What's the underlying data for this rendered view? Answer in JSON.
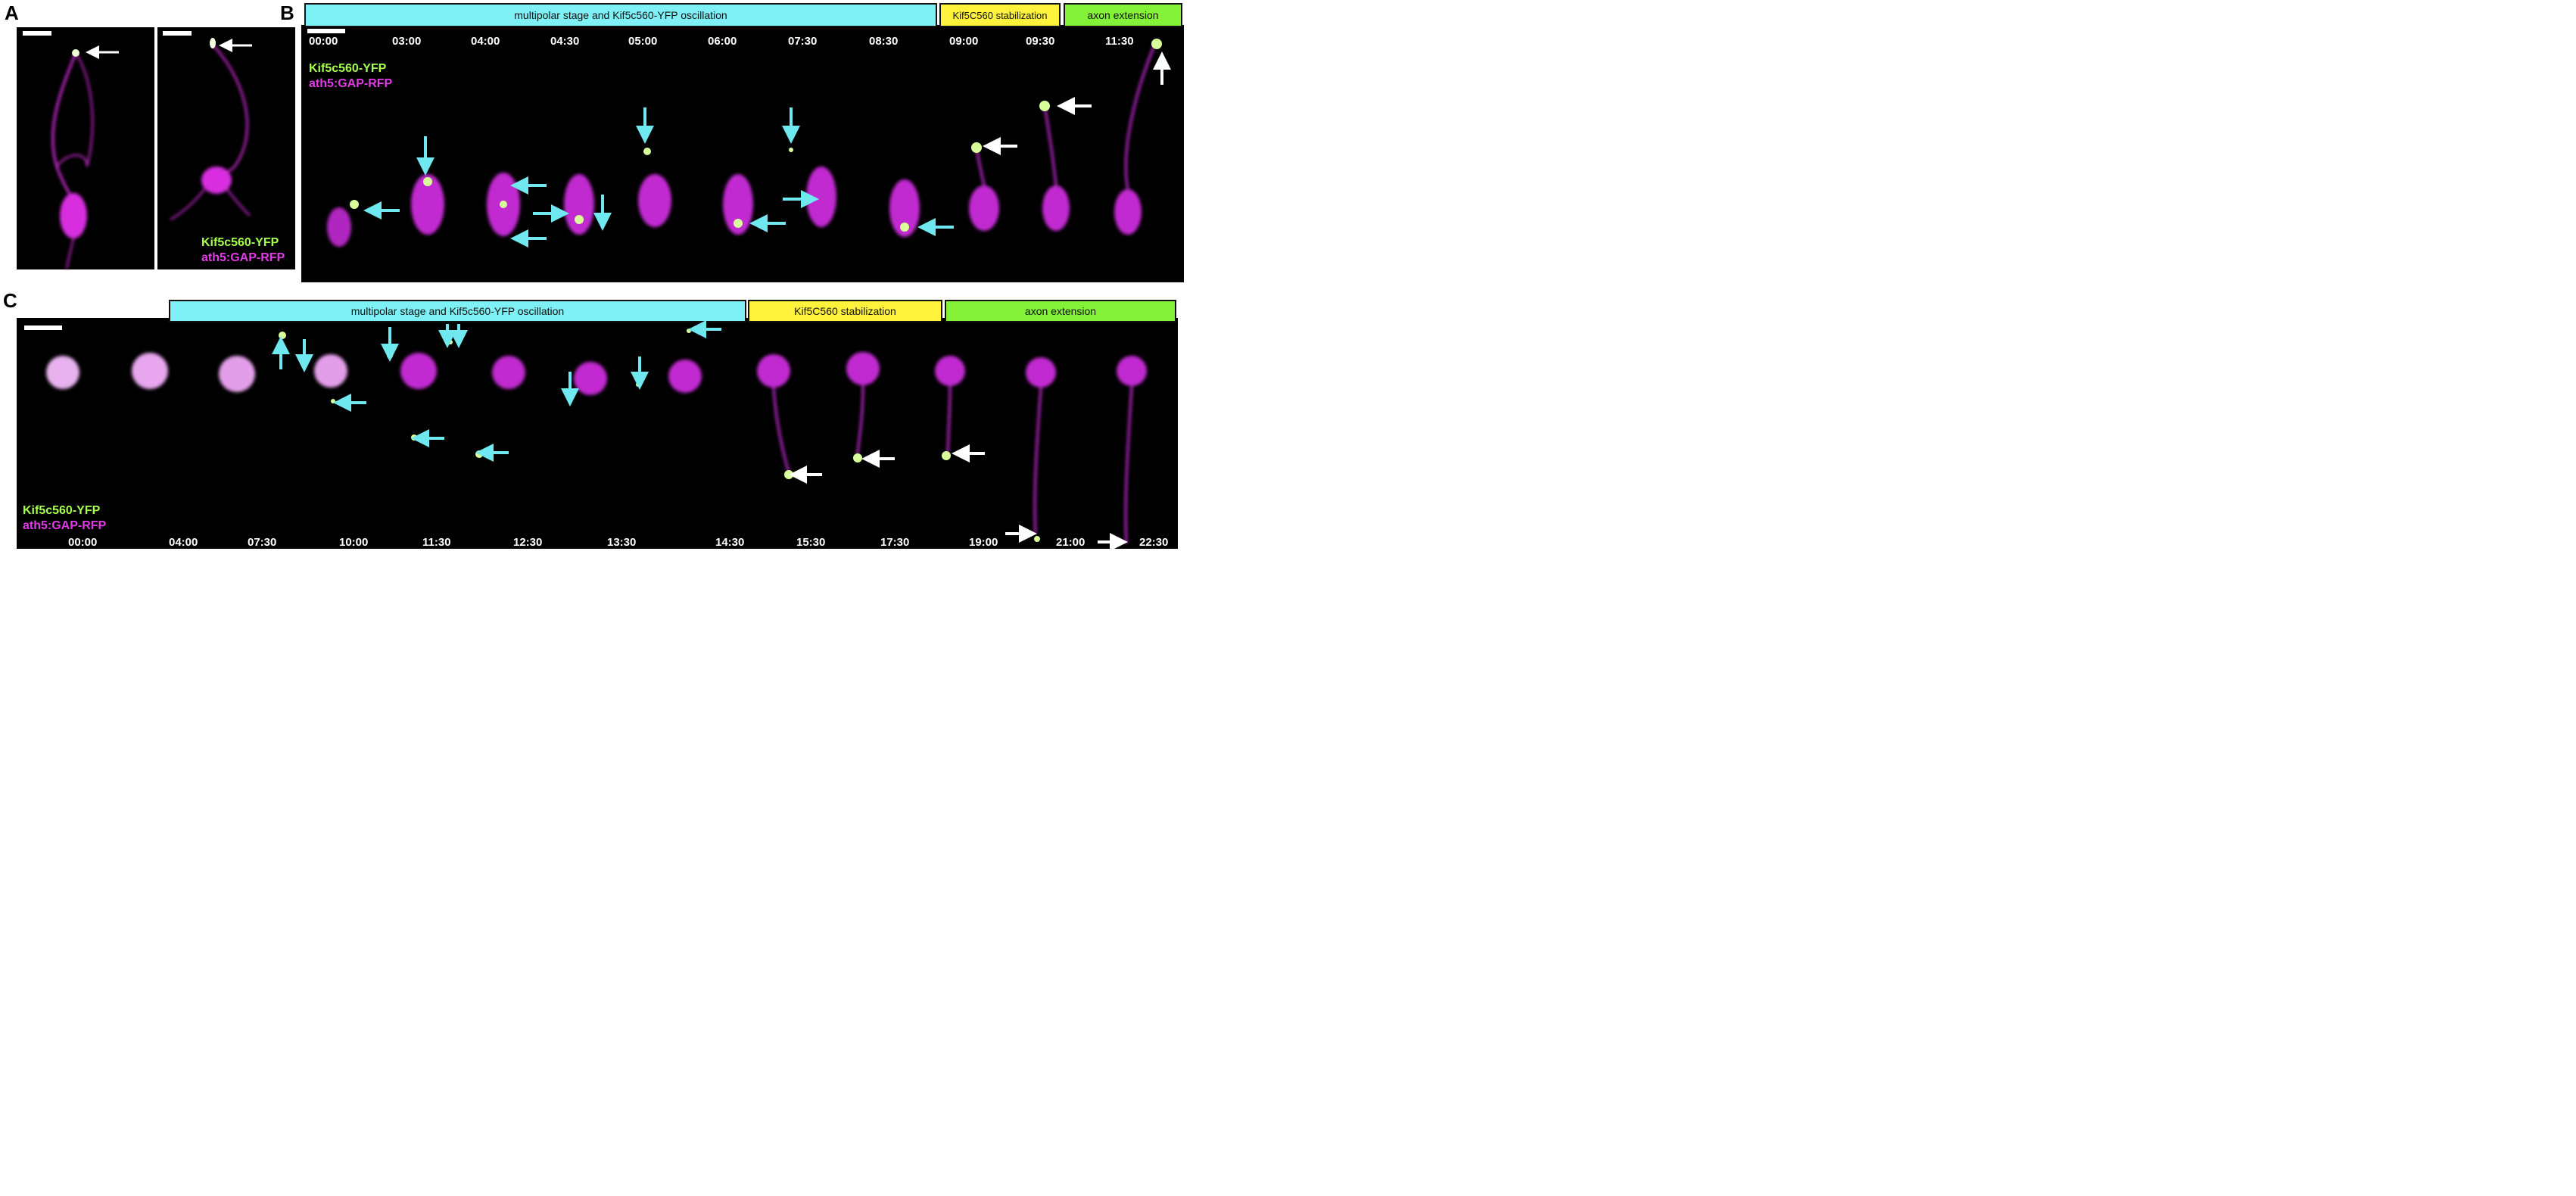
{
  "panels": {
    "A": {
      "label": "A",
      "legend": {
        "marker": "Kif5c560-YFP",
        "membrane": "ath5:GAP-RFP"
      }
    },
    "B": {
      "label": "B",
      "stages": [
        {
          "label": "multipolar stage and Kif5c560-YFP oscillation",
          "color": "#7ff0f5"
        },
        {
          "label": "Kif5C560 stabilization",
          "color": "#fff23d"
        },
        {
          "label": "axon extension",
          "color": "#84f238"
        }
      ],
      "timepoints": [
        "00:00",
        "03:00",
        "04:00",
        "04:30",
        "05:00",
        "06:00",
        "07:30",
        "08:30",
        "09:00",
        "09:30",
        "11:30"
      ],
      "legend": {
        "marker": "Kif5c560-YFP",
        "membrane": "ath5:GAP-RFP"
      }
    },
    "C": {
      "label": "C",
      "stages": [
        {
          "label": "multipolar stage and Kif5c560-YFP oscillation",
          "color": "#7ff0f5"
        },
        {
          "label": "Kif5C560 stabilization",
          "color": "#fff23d"
        },
        {
          "label": "axon extension",
          "color": "#84f238"
        }
      ],
      "timepoints": [
        "00:00",
        "04:00",
        "07:30",
        "10:00",
        "11:30",
        "12:30",
        "13:30",
        "14:30",
        "15:30",
        "17:30",
        "19:00",
        "21:00",
        "22:30"
      ],
      "legend": {
        "marker": "Kif5c560-YFP",
        "membrane": "ath5:GAP-RFP"
      }
    }
  },
  "colors": {
    "background": "#000000",
    "membrane": "#d82ee0",
    "marker": "#b8ff6a",
    "cyan_arrow": "#6fe8ef",
    "white_arrow": "#ffffff"
  }
}
